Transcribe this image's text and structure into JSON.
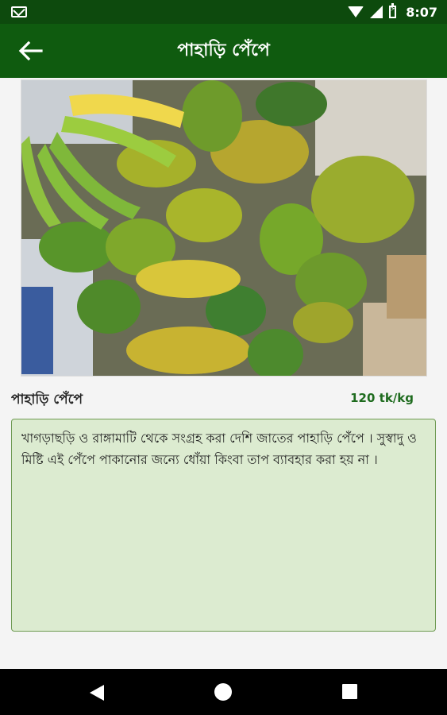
{
  "status_bar": {
    "time": "8:07",
    "icons": [
      "gmail-icon",
      "wifi-icon",
      "signal-icon",
      "battery-icon"
    ]
  },
  "app_bar": {
    "title": "পাহাড়ি পেঁপে",
    "back_icon": "arrow-left-icon"
  },
  "product": {
    "name": "পাহাড়ি পেঁপে",
    "price": "120 tk/kg",
    "description": "খাগড়াছড়ি ও রাঙ্গামাটি থেকে সংগ্রহ করা দেশি জাতের পাহাড়ি পেঁপে । সুস্বাদু ও মিষ্টি এই পেঁপে পাকানোর জন্যে ধোঁয়া কিংবা তাপ ব্যাবহার করা হয় না ।"
  },
  "colors": {
    "status_bar": "#0d4a0d",
    "app_bar": "#0f5b0f",
    "price": "#1e6b1e",
    "desc_bg": "#dcebd0",
    "desc_border": "#6e9a52"
  },
  "nav_bar": {
    "icons": [
      "back-triangle-icon",
      "home-circle-icon",
      "recents-square-icon"
    ]
  }
}
